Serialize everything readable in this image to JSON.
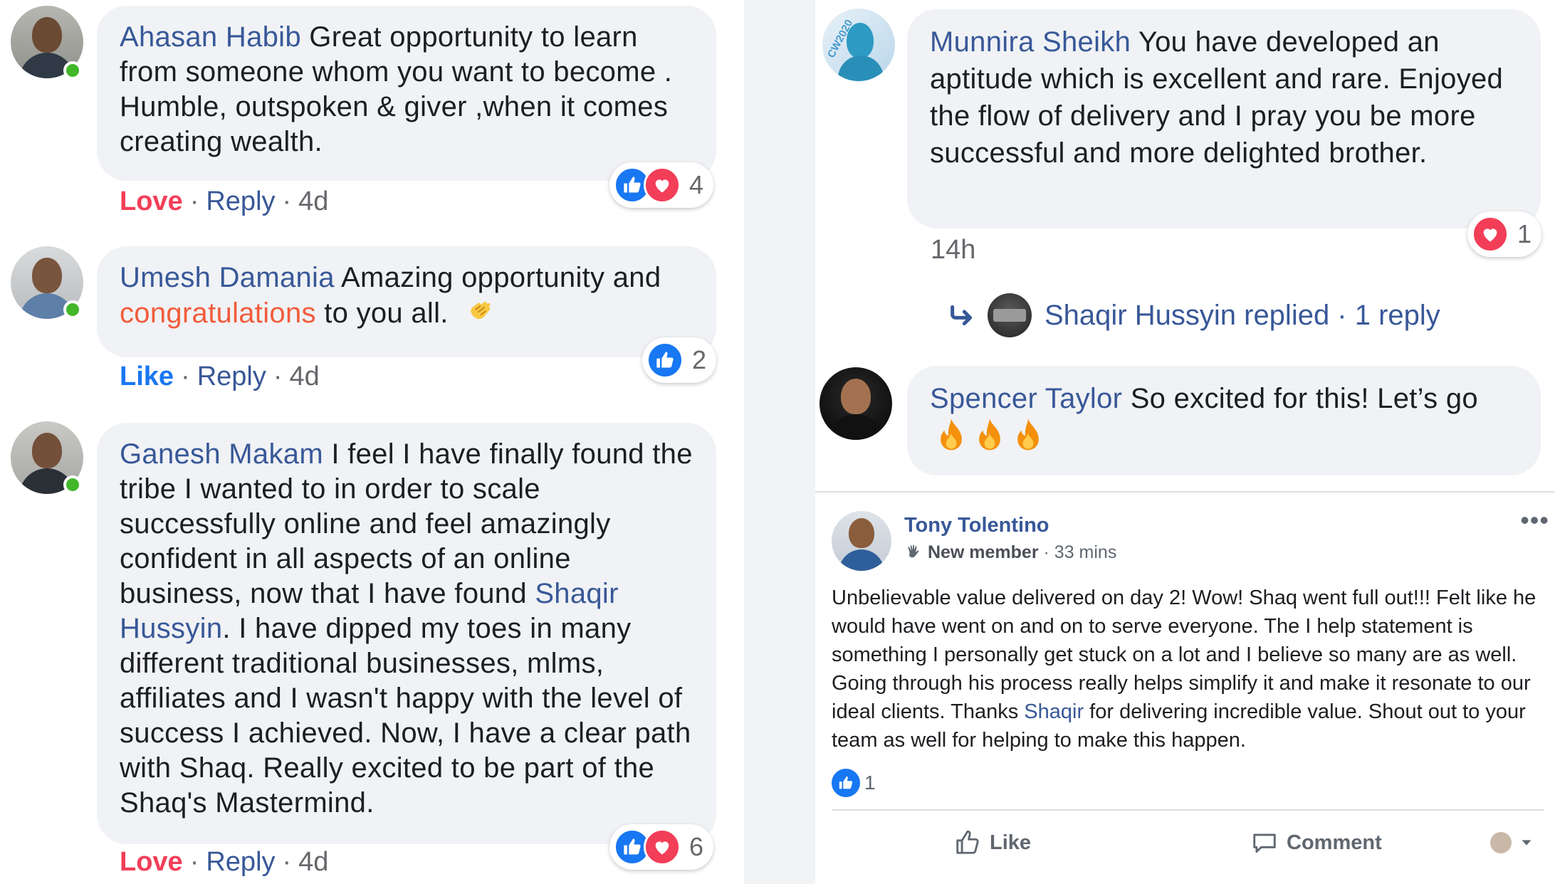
{
  "left_comments": [
    {
      "author": "Ahasan Habib",
      "text": " Great opportunity to learn from someone whom you want to become . Humble, outspoken & giver ,when it comes creating wealth.",
      "reaction_label": "Love",
      "reply_label": "Reply",
      "time": "4d",
      "reaction_count": "4"
    },
    {
      "author": "Umesh Damania",
      "text_before": " Amazing opportunity and ",
      "highlight": "congratulations",
      "text_after": " to you all.",
      "reaction_label": "Like",
      "reply_label": "Reply",
      "time": "4d",
      "reaction_count": "2"
    },
    {
      "author": "Ganesh Makam",
      "text_before": " I feel I have finally found the tribe I wanted to in order to scale successfully online and feel amazingly confident in all aspects of an online business, now that I have found ",
      "tag": "Shaqir Hussyin",
      "text_after": ". I have dipped my toes in many different traditional businesses, mlms, affiliates and I wasn't happy with the level of success I achieved. Now, I have a clear path with Shaq. Really excited to be part of the Shaq's Mastermind.",
      "reaction_label": "Love",
      "reply_label": "Reply",
      "time": "4d",
      "reaction_count": "6"
    }
  ],
  "right_comments": [
    {
      "author": "Munnira Sheikh",
      "text": " You have developed an aptitude which is excellent and rare. Enjoyed the flow of delivery and I pray you be more successful and more delighted brother.",
      "time": "14h",
      "reaction_count": "1",
      "replies_label": "Shaqir Hussyin replied · 1 reply",
      "avatar_text": "CW2020"
    },
    {
      "author": "Spencer Taylor",
      "text": " So excited for this! Let’s go"
    }
  ],
  "post": {
    "author": "Tony Tolentino",
    "badge": "New member",
    "time": " · 33 mins",
    "body_before": "Unbelievable value delivered on day 2! Wow! Shaq went full out!!! Felt like he would have went on and on to serve everyone. The I help statement is something I personally get stuck on a lot and I believe so many are as well. Going through his process really helps simplify it and make it resonate to our ideal clients. Thanks ",
    "body_tag": "Shaqir",
    "body_after": " for delivering incredible value. Shout out to your team as well for helping to make this happen.",
    "like_count": "1",
    "like_label": "Like",
    "comment_label": "Comment",
    "more_label": "•••"
  },
  "colors": {
    "link_blue": "#385898",
    "love_red": "#f33e58",
    "like_blue": "#1877f2",
    "online_green": "#42b72a",
    "bubble_bg": "#f0f2f5"
  }
}
